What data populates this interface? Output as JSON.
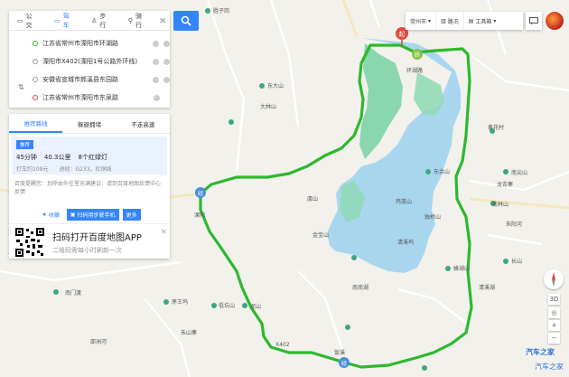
{
  "modes": [
    {
      "label": "公交",
      "icon": "bus-icon"
    },
    {
      "label": "驾车",
      "icon": "car-icon",
      "active": true
    },
    {
      "label": "步行",
      "icon": "walk-icon"
    },
    {
      "label": "骑行",
      "icon": "bike-icon"
    }
  ],
  "waypoints": [
    "江苏省常州市溧阳市环湖路",
    "溧阳市X402(溧阳1号公路外环线)",
    "安徽省宣城市郎溪县东园路",
    "江苏省常州市溧阳市东泉路"
  ],
  "plan_tabs": [
    "推荐路线",
    "躲避拥堵",
    "不走高速"
  ],
  "plan": {
    "badge": "推荐",
    "time": "45分钟",
    "distance": "40.3公里",
    "lights": "8个红绿灯",
    "taxi": "打车约109元",
    "via": "途经：G233，杜铜线"
  },
  "tip": "百度提醒您：划岸由外往里充满建议：请到百度地图反馈中心反馈",
  "actions": {
    "favorite": "收藏",
    "send_phone": "扫码用步驶手机",
    "more": "更多"
  },
  "promo": {
    "title": "扫码打开百度地图APP",
    "subtitle": "二维码需每小时刷新一次"
  },
  "topbar": {
    "city": "常州市",
    "traffic": "路况",
    "tools": "工具箱"
  },
  "map_labels": [
    "胜子岗",
    "环湖路",
    "东大山",
    "大林山",
    "黄花村",
    "东余山",
    "龙舌寨",
    "南尖山",
    "虞山",
    "金宝山",
    "南门渡",
    "溧阳",
    "蜂湖山",
    "独桥山",
    "清溪坞",
    "南林山",
    "长山",
    "南南湖",
    "低坑山",
    "泥山",
    "饭溪",
    "茅王坞",
    "鸡笼山",
    "朱山寨",
    "邵洲河",
    "朱阳河",
    "清溪湖",
    "X402"
  ],
  "watermark": {
    "main": "汽车之家",
    "sub": "汽车之家"
  },
  "colors": {
    "route": "#2eb82e",
    "water": "#a9d6ef",
    "forest": "#7dd3a8",
    "accent": "#3385ff"
  }
}
